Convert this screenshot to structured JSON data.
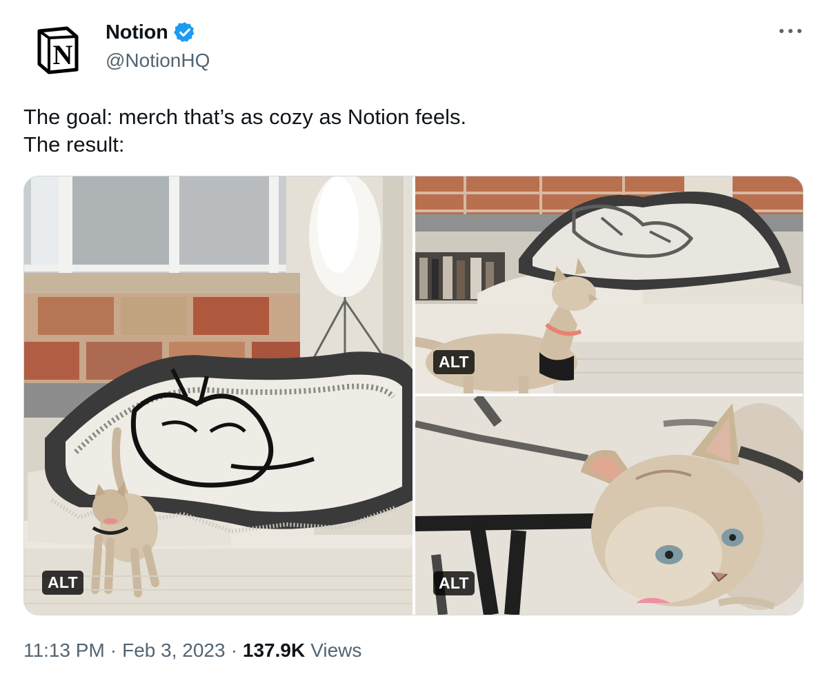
{
  "author": {
    "display_name": "Notion",
    "handle": "@NotionHQ",
    "avatar_letter": "N",
    "verified": true,
    "verified_color": "#1d9bf0"
  },
  "more_icon": "more-horizontal-icon",
  "text": {
    "line1": "The goal: merch that’s as cozy as Notion feels.",
    "line2": "The result:"
  },
  "media": {
    "photos": [
      {
        "alt_label": "ALT"
      },
      {
        "alt_label": "ALT"
      },
      {
        "alt_label": "ALT"
      }
    ]
  },
  "footer": {
    "time": "11:13 PM",
    "separator": "·",
    "date": "Feb 3, 2023",
    "views_count": "137.9K",
    "views_label": "Views"
  },
  "colors": {
    "text": "#0f1419",
    "secondary": "#536471",
    "border": "#cfd9de"
  }
}
